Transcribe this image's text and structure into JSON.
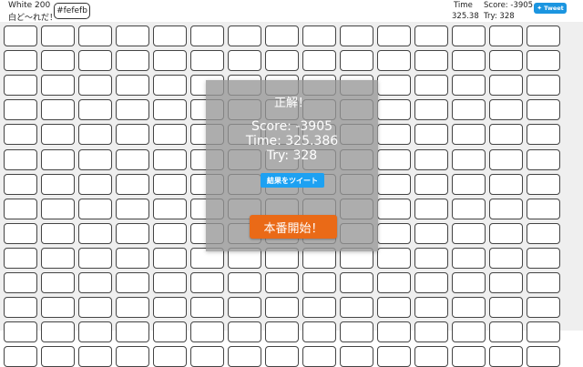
{
  "header": {
    "level_title": "White 200",
    "level_subtitle": "白ど〜れだ！",
    "color_code": "#fefefb",
    "time_label": "Time",
    "time_value": "325.38",
    "score_label": "Score: -3905",
    "try_label": "Try: 328",
    "tweet_label": "Tweet"
  },
  "board": {
    "rows": 14,
    "columns": 15,
    "tile_color": "#ffffff",
    "background": "#efefef"
  },
  "result_overlay": {
    "title": "正解！",
    "score_text": "Score: -3905",
    "time_text": "Time: 325.386",
    "try_text": "Try: 328",
    "share_label": "結果をツイート",
    "start_label": "本番開始！"
  },
  "colors": {
    "tweet": "#1b95e0",
    "share": "#1da1f2",
    "start": "#ea6a17"
  }
}
